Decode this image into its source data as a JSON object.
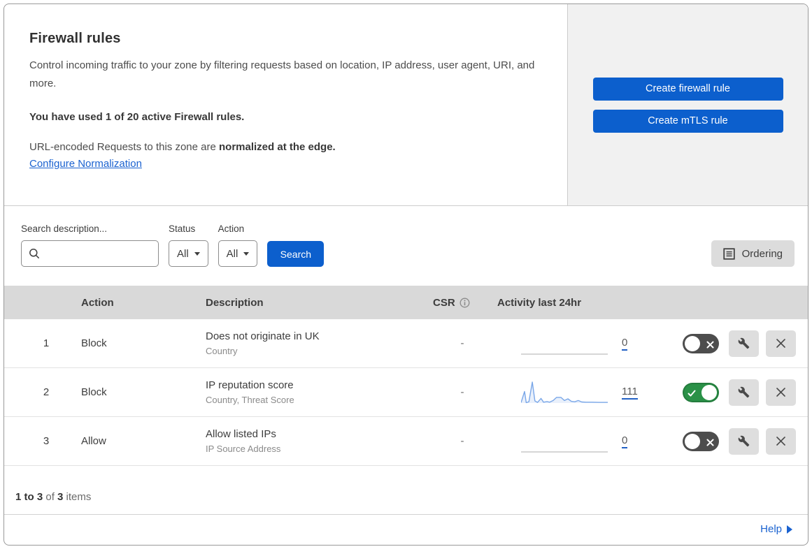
{
  "colors": {
    "primary_button": "#0c5fcd",
    "link": "#1a62d0",
    "toggle_on": "#2a9147",
    "toggle_off": "#4d4d4d",
    "sparkline_stroke": "#7aa7e8",
    "sparkline_fill": "#e9f0fb",
    "flat_line": "#c9c9c9",
    "table_header_bg": "#d9d9d9"
  },
  "intro": {
    "title": "Firewall rules",
    "description": "Control incoming traffic to your zone by filtering requests based on location, IP address, user agent, URI, and more.",
    "usage": "You have used 1 of 20 active Firewall rules.",
    "normalization_text": "URL-encoded Requests to this zone are ",
    "normalization_bold": "normalized at the edge.",
    "normalization_link": "Configure Normalization"
  },
  "actions_panel": {
    "create_firewall_label": "Create firewall rule",
    "create_mtls_label": "Create mTLS rule"
  },
  "filters": {
    "search_label": "Search description...",
    "status_label": "Status",
    "status_value": "All",
    "action_label": "Action",
    "action_value": "All",
    "search_button_label": "Search",
    "ordering_button_label": "Ordering"
  },
  "table": {
    "headers": {
      "action": "Action",
      "description": "Description",
      "csr": "CSR",
      "activity": "Activity last 24hr"
    },
    "rows": [
      {
        "index": "1",
        "action": "Block",
        "description": "Does not originate in UK",
        "criteria": "Country",
        "csr": "-",
        "activity_count": "0",
        "enabled": false,
        "sparkline": null
      },
      {
        "index": "2",
        "action": "Block",
        "description": "IP reputation score",
        "criteria": "Country, Threat Score",
        "csr": "-",
        "activity_count": "111",
        "enabled": true,
        "sparkline": [
          [
            0,
            2
          ],
          [
            4,
            55
          ],
          [
            6,
            2
          ],
          [
            9,
            6
          ],
          [
            13,
            100
          ],
          [
            16,
            10
          ],
          [
            19,
            3
          ],
          [
            23,
            22
          ],
          [
            26,
            4
          ],
          [
            30,
            7
          ],
          [
            33,
            4
          ],
          [
            37,
            12
          ],
          [
            41,
            27
          ],
          [
            46,
            27
          ],
          [
            50,
            12
          ],
          [
            54,
            20
          ],
          [
            58,
            8
          ],
          [
            62,
            6
          ],
          [
            66,
            12
          ],
          [
            70,
            5
          ],
          [
            75,
            4
          ],
          [
            82,
            4
          ],
          [
            90,
            3
          ],
          [
            100,
            3
          ]
        ]
      },
      {
        "index": "3",
        "action": "Allow",
        "description": "Allow listed IPs",
        "criteria": "IP Source Address",
        "csr": "-",
        "activity_count": "0",
        "enabled": false,
        "sparkline": null
      }
    ]
  },
  "footer": {
    "count_range": "1 to 3",
    "count_of": " of ",
    "count_total": "3",
    "count_items": " items",
    "help_label": "Help"
  }
}
